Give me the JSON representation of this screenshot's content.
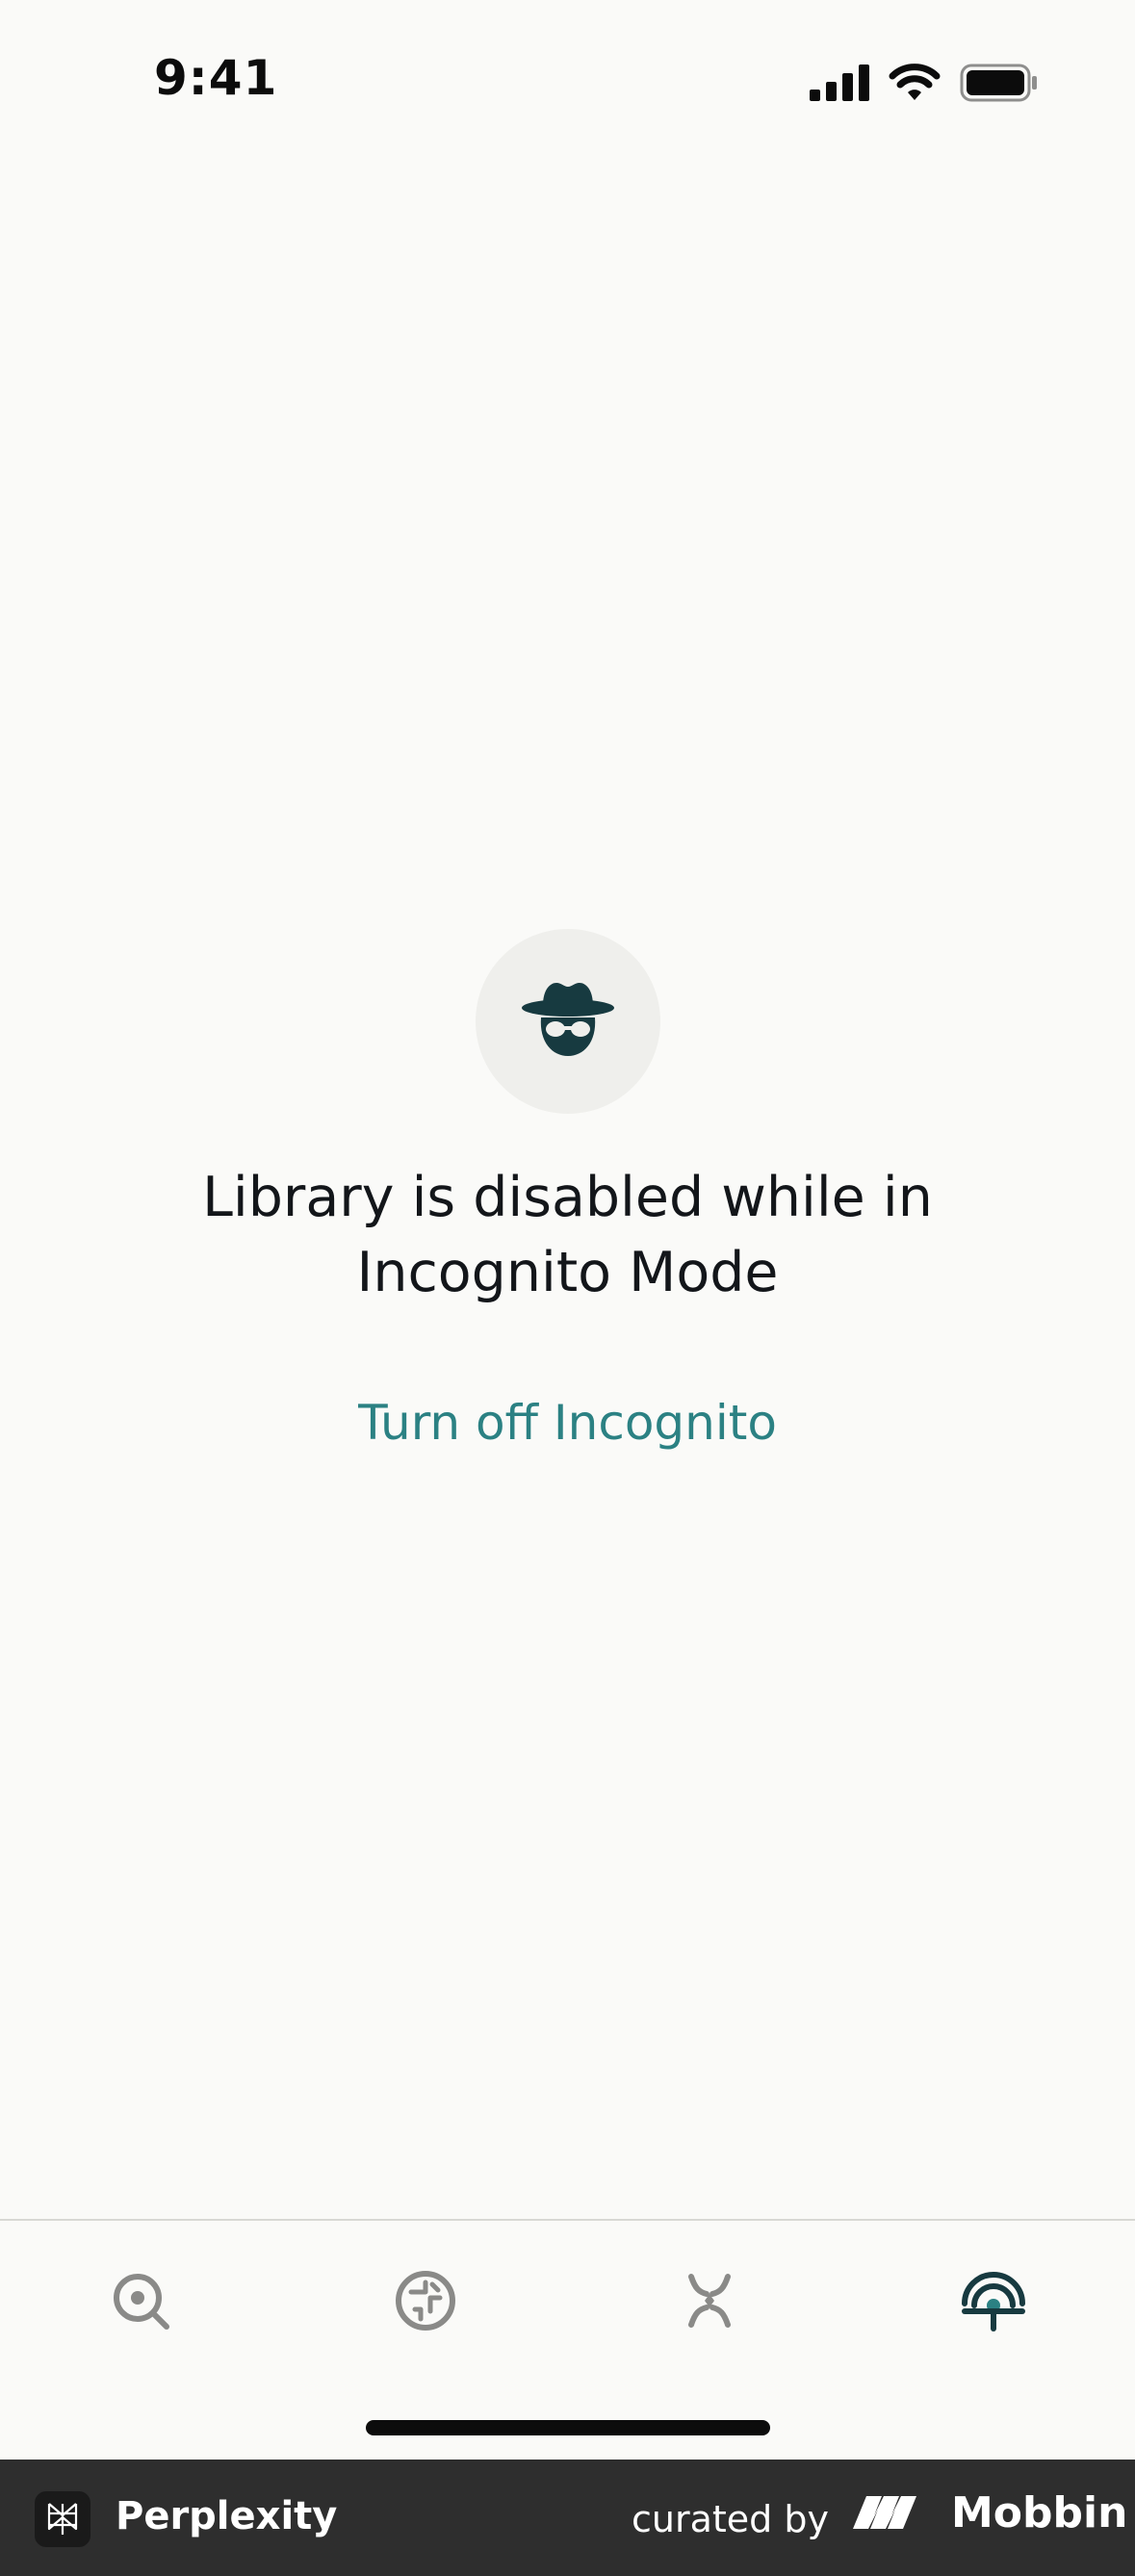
{
  "status_bar": {
    "time": "9:41",
    "icons": [
      "cellular-signal-icon",
      "wifi-icon",
      "battery-icon"
    ]
  },
  "empty_state": {
    "icon": "incognito-icon",
    "message": "Library is disabled while in Incognito Mode",
    "action_label": "Turn off Incognito"
  },
  "tab_bar": {
    "tabs": [
      {
        "icon": "search-icon",
        "active": false
      },
      {
        "icon": "discover-icon",
        "active": false
      },
      {
        "icon": "spaces-icon",
        "active": false
      },
      {
        "icon": "library-icon",
        "active": true
      }
    ]
  },
  "footer": {
    "app_name": "Perplexity",
    "curated_by": "curated by",
    "brand": "Mobbin"
  },
  "colors": {
    "background": "#fafaf8",
    "accent": "#2b8183",
    "icon_dark": "#173a40",
    "icon_inactive": "#8a8a88",
    "footer_bg": "#2e2e2e"
  }
}
